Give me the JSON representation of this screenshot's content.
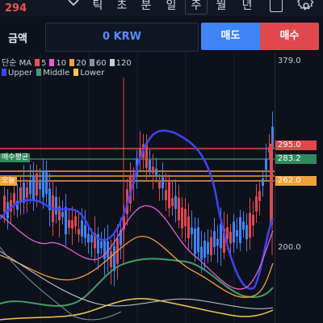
{
  "header": {
    "price": "294",
    "timeframes": [
      {
        "label": "틱",
        "selected": false
      },
      {
        "label": "초",
        "selected": false
      },
      {
        "label": "분",
        "selected": false
      },
      {
        "label": "일",
        "selected": false
      },
      {
        "label": "주",
        "selected": true
      },
      {
        "label": "월",
        "selected": false
      },
      {
        "label": "년",
        "selected": false
      }
    ]
  },
  "order": {
    "asset_label": "금액",
    "amount": "0 KRW",
    "buy_label": "매도",
    "sell_label": "매수"
  },
  "legend": {
    "ma_label": "단순 MA",
    "ma_periods": [
      {
        "label": "5",
        "color": "#e9534f"
      },
      {
        "label": "10",
        "color": "#e95bd8"
      },
      {
        "label": "20",
        "color": "#f0a23a"
      },
      {
        "label": "60",
        "color": "#8a8f99"
      },
      {
        "label": "120",
        "color": "#c7cbd3"
      }
    ],
    "bb": [
      {
        "label": "Upper",
        "color": "#3d46f0"
      },
      {
        "label": "Middle",
        "color": "#3f9d6a"
      },
      {
        "label": "Lower",
        "color": "#f3c94a"
      }
    ]
  },
  "axis": {
    "top": "379.0",
    "bottom": "200.0",
    "tags": [
      {
        "label": "295.0",
        "color": "#e0484e"
      },
      {
        "label": "283.2",
        "color": "#2f8a5f"
      },
      {
        "label": "262.0",
        "color": "#f0a23a"
      }
    ]
  },
  "levels": {
    "avg_label": "매수평균",
    "today_label": "오늘"
  },
  "colors": {
    "up": "#e0484e",
    "down": "#3f84f6",
    "bg": "#0d111b"
  }
}
